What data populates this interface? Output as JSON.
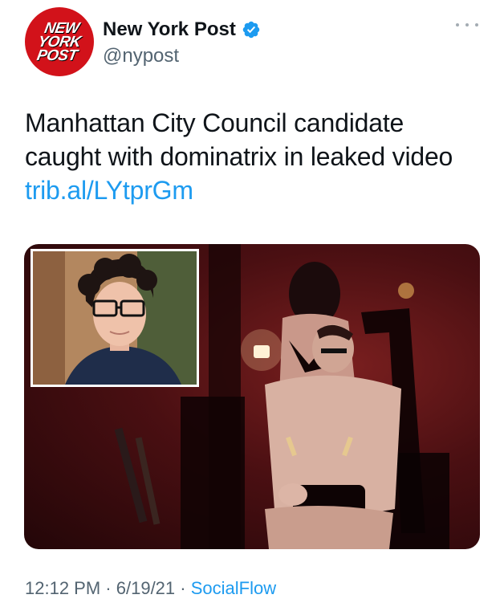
{
  "tweet": {
    "author": {
      "display_name": "New York Post",
      "handle": "@nypost",
      "verified": true,
      "avatar_logo_lines": [
        "NEW",
        "YORK",
        "POST"
      ],
      "avatar_color": "#d2121a"
    },
    "text_lines": [
      "Manhattan City Council candidate",
      "caught with dominatrix in leaked video"
    ],
    "link": "trib.al/LYtprGm",
    "meta": {
      "time": "12:12 PM",
      "separator": "·",
      "date": "6/19/21",
      "source": "SocialFlow"
    }
  },
  "icons": {
    "verified": "verified-badge-icon",
    "more": "more-options-icon"
  },
  "colors": {
    "link": "#1d9bf0",
    "secondary_text": "#536471",
    "verified": "#1d9bf0"
  }
}
